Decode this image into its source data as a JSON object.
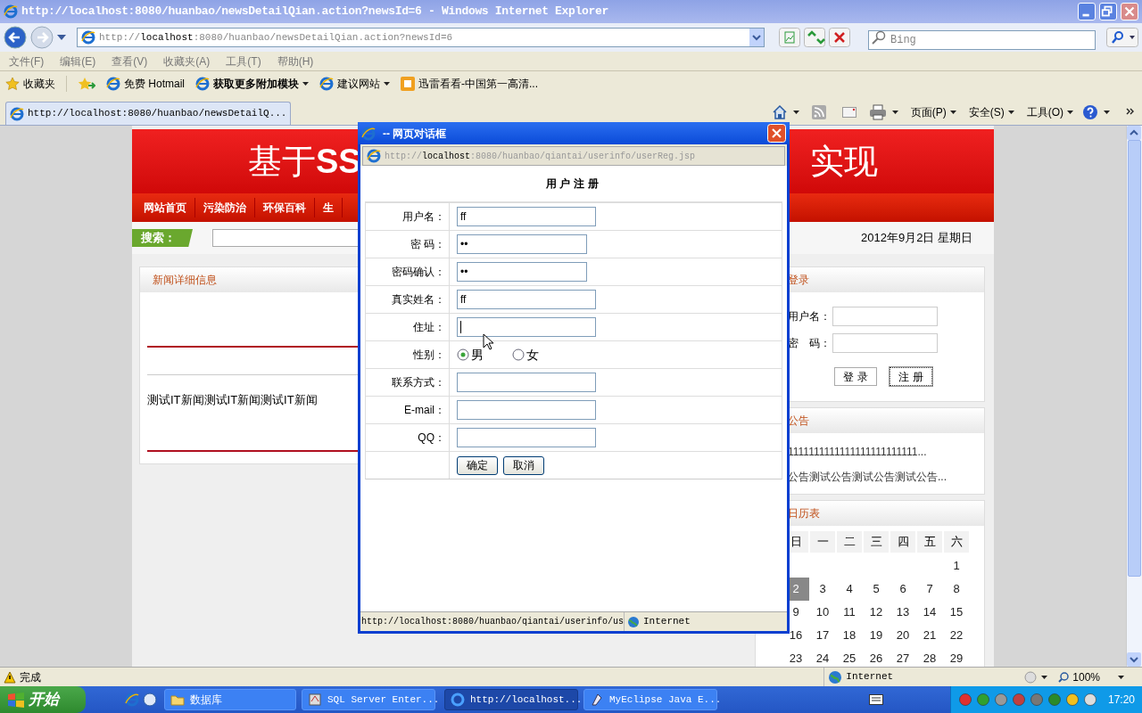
{
  "window": {
    "title": "http://localhost:8080/huanbao/newsDetailQian.action?newsId=6 - Windows Internet Explorer"
  },
  "address_bar": {
    "url": "http://**localhost**:8080/huanbao/newsDetailQian.action?newsId=6"
  },
  "search": {
    "placeholder": "Bing"
  },
  "menu": [
    "文件(F)",
    "编辑(E)",
    "查看(V)",
    "收藏夹(A)",
    "工具(T)",
    "帮助(H)"
  ],
  "favorites_bar": {
    "label": "收藏夹",
    "items": [
      {
        "label": "免费 Hotmail",
        "dropdown": false
      },
      {
        "label": "获取更多附加模块",
        "dropdown": true
      },
      {
        "label": "建议网站",
        "dropdown": true
      },
      {
        "label": "迅雷看看-中国第一高清...",
        "dropdown": false
      }
    ]
  },
  "tab": {
    "title": "http://localhost:8080/huanbao/newsDetailQ..."
  },
  "command_bar": [
    "页面(P)",
    "安全(S)",
    "工具(O)"
  ],
  "page": {
    "banner": {
      "title_left": "基于**SS**",
      "title_right": "实现"
    },
    "nav": [
      "网站首页",
      "污染防治",
      "环保百科",
      "生"
    ],
    "search_label": "搜索：",
    "date": "2012年9月2日 星期日",
    "news_panel": {
      "title": "新闻详细信息",
      "body": "测试IT新闻测试IT新闻测试IT新闻"
    },
    "login_panel": {
      "title": "登录",
      "fields": [
        "用户名：",
        "密　码："
      ],
      "buttons": [
        "登 录",
        "注 册"
      ]
    },
    "notice_panel": {
      "title": "公告",
      "items": [
        "1111111111111111111111111...",
        "公告测试公告测试公告测试公告..."
      ]
    },
    "calendar": {
      "title": "日历表",
      "weekdays": [
        "日",
        "一",
        "二",
        "三",
        "四",
        "五",
        "六"
      ],
      "days": [
        {
          "kind": "blank"
        },
        {
          "kind": "blank"
        },
        {
          "kind": "blank"
        },
        {
          "kind": "blank"
        },
        {
          "kind": "blank"
        },
        {
          "kind": "blank"
        },
        {
          "d": "1",
          "selected": false
        },
        {
          "d": "2",
          "selected": true
        },
        {
          "d": "3",
          "selected": false
        },
        {
          "d": "4",
          "selected": false
        },
        {
          "d": "5",
          "selected": false
        },
        {
          "d": "6",
          "selected": false
        },
        {
          "d": "7",
          "selected": false
        },
        {
          "d": "8",
          "selected": false
        },
        {
          "d": "9",
          "selected": false
        },
        {
          "d": "10",
          "selected": false
        },
        {
          "d": "11",
          "selected": false
        },
        {
          "d": "12",
          "selected": false
        },
        {
          "d": "13",
          "selected": false
        },
        {
          "d": "14",
          "selected": false
        },
        {
          "d": "15",
          "selected": false
        },
        {
          "d": "16",
          "selected": false
        },
        {
          "d": "17",
          "selected": false
        },
        {
          "d": "18",
          "selected": false
        },
        {
          "d": "19",
          "selected": false
        },
        {
          "d": "20",
          "selected": false
        },
        {
          "d": "21",
          "selected": false
        },
        {
          "d": "22",
          "selected": false
        },
        {
          "d": "23",
          "selected": false
        },
        {
          "d": "24",
          "selected": false
        },
        {
          "d": "25",
          "selected": false
        },
        {
          "d": "26",
          "selected": false
        },
        {
          "d": "27",
          "selected": false
        },
        {
          "d": "28",
          "selected": false
        },
        {
          "d": "29",
          "selected": false
        }
      ]
    }
  },
  "dialog": {
    "title": "-- 网页对话框",
    "url": "http://**localhost**:8080/huanbao/qiantai/userinfo/userReg.jsp",
    "heading": "用户注册",
    "rows": [
      {
        "kind": "input",
        "label": "用户名：",
        "value": "ff",
        "focused": false
      },
      {
        "kind": "password",
        "label": "密 码：",
        "value": "••",
        "focused": false
      },
      {
        "kind": "password",
        "label": "密码确认：",
        "value": "••",
        "focused": false
      },
      {
        "kind": "input",
        "label": "真实姓名：",
        "value": "ff",
        "focused": false
      },
      {
        "kind": "input",
        "label": "住址：",
        "focused": true
      },
      {
        "kind": "radio",
        "label": "性别：",
        "options": [
          {
            "label": "男",
            "selected": true
          },
          {
            "label": "女",
            "selected": false
          }
        ]
      },
      {
        "kind": "input",
        "label": "联系方式：",
        "focused": false
      },
      {
        "kind": "input",
        "label": "E-mail：",
        "focused": false
      },
      {
        "kind": "input",
        "label": "QQ：",
        "focused": false
      }
    ],
    "buttons": [
      "确定",
      "取消"
    ],
    "status_url": "http://localhost:8080/huanbao/qiantai/userinfo/us",
    "status_zone": "Internet"
  },
  "status_bar": {
    "text": "完成",
    "zone": "Internet",
    "zoom": "100%"
  },
  "taskbar": {
    "start": "开始",
    "tasks": [
      {
        "kind": "folder",
        "label": "数据库",
        "selected": false
      },
      {
        "kind": "database",
        "label": "SQL Server Enter...",
        "selected": false
      },
      {
        "kind": "browser",
        "label": "http://localhost...",
        "selected": true
      },
      {
        "kind": "ide",
        "label": "MyEclipse Java E...",
        "selected": false
      }
    ],
    "clock": "17:20"
  }
}
